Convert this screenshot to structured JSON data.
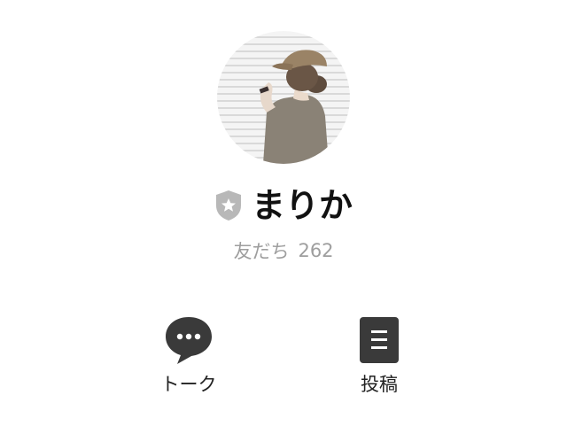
{
  "profile": {
    "name": "まりか",
    "friends_label": "友だち",
    "friends_count": "262"
  },
  "icons": {
    "badge": "shield-star-icon",
    "talk": "speech-bubble-icon",
    "posts": "document-icon"
  },
  "actions": {
    "talk_label": "トーク",
    "posts_label": "投稿"
  },
  "colors": {
    "icon_dark": "#3a3a3a",
    "badge_gray": "#b8b8b8",
    "muted_text": "#9e9e9e"
  }
}
